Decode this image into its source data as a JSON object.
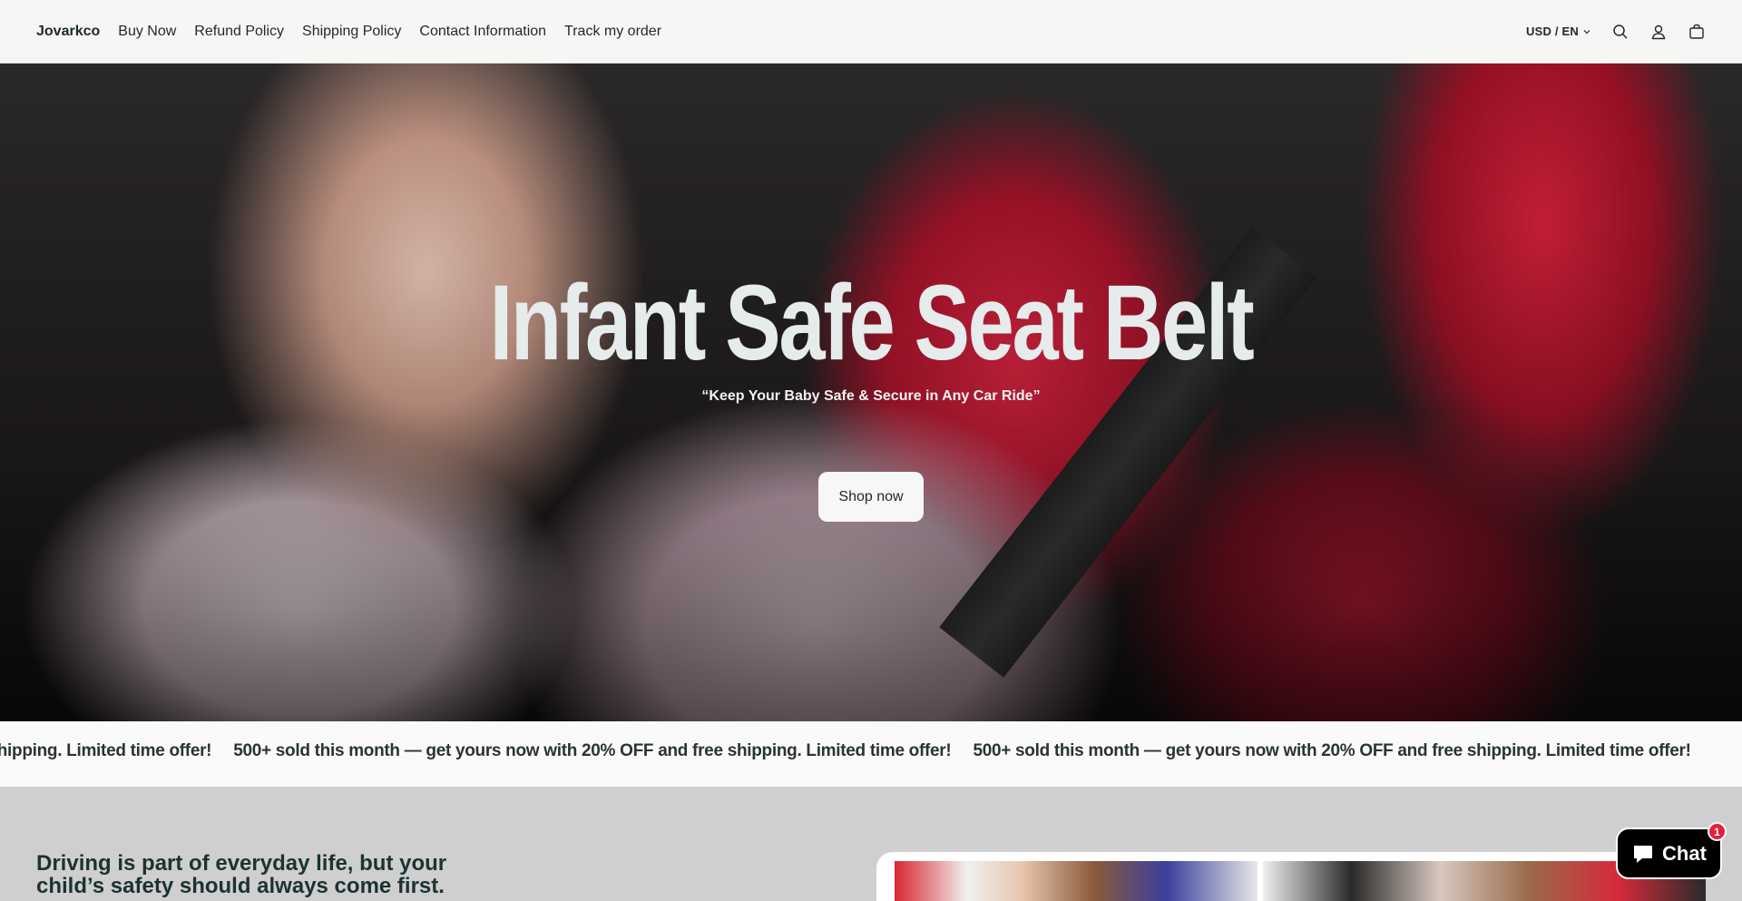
{
  "header": {
    "brand": "Jovarkco",
    "nav": [
      {
        "label": "Buy Now"
      },
      {
        "label": "Refund Policy"
      },
      {
        "label": "Shipping Policy"
      },
      {
        "label": "Contact Information"
      },
      {
        "label": "Track my order"
      }
    ],
    "locale": "USD / EN",
    "icons": [
      "search-icon",
      "account-icon",
      "cart-icon"
    ]
  },
  "hero": {
    "title": "Infant Safe Seat Belt",
    "subtitle": "“Keep Your Baby Safe & Secure in Any Car Ride”",
    "cta": "Shop now"
  },
  "marquee": {
    "items": [
      "500+ sold this month — get yours now with 20% OFF and free shipping. Limited time offer!",
      "500+ sold this month — get yours now with 20% OFF and free shipping. Limited time offer!",
      "500+ sold this month — get yours now with 20% OFF and free shipping. Limited time offer!"
    ]
  },
  "section": {
    "heading": "Driving is part of everyday life, but your child’s safety should always come first."
  },
  "chat": {
    "label": "Chat",
    "badge": "1"
  },
  "colors": {
    "header_bg": "#f6f6f4",
    "text_dark": "#1d2a2a",
    "section_bg": "#cfcfcf",
    "chat_bg": "#000000",
    "badge": "#e3203a"
  }
}
